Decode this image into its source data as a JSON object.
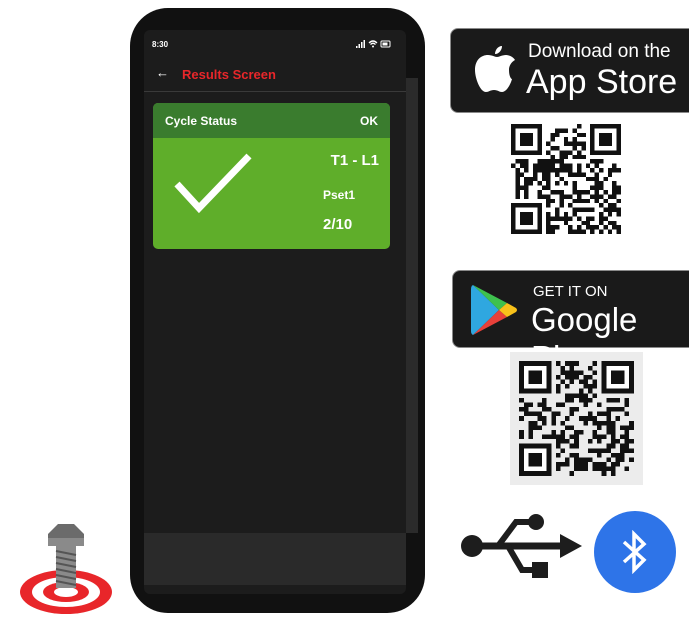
{
  "phone": {
    "status_time": "8:30",
    "status_icons": "signal wifi battery",
    "back_icon": "back-arrow-icon",
    "screen_title": "Results Screen",
    "title_color": "#e8262a"
  },
  "card": {
    "header_label": "Cycle Status",
    "header_status": "OK",
    "tool_line": "T1 - L1",
    "pset": "Pset1",
    "count": "2/10",
    "header_color": "#3a7c2e",
    "body_color": "#5fae2a",
    "icon": "checkmark-icon"
  },
  "badges": {
    "appstore_small": "Download on the",
    "appstore_big": "App Store",
    "gplay_small": "GET IT ON",
    "gplay_big": "Google Play"
  },
  "icons": {
    "usb": "usb-icon",
    "bluetooth": "bluetooth-icon",
    "bolt_target": "bolt-target-logo",
    "bluetooth_color": "#2e74e8",
    "target_color": "#e8262a"
  }
}
